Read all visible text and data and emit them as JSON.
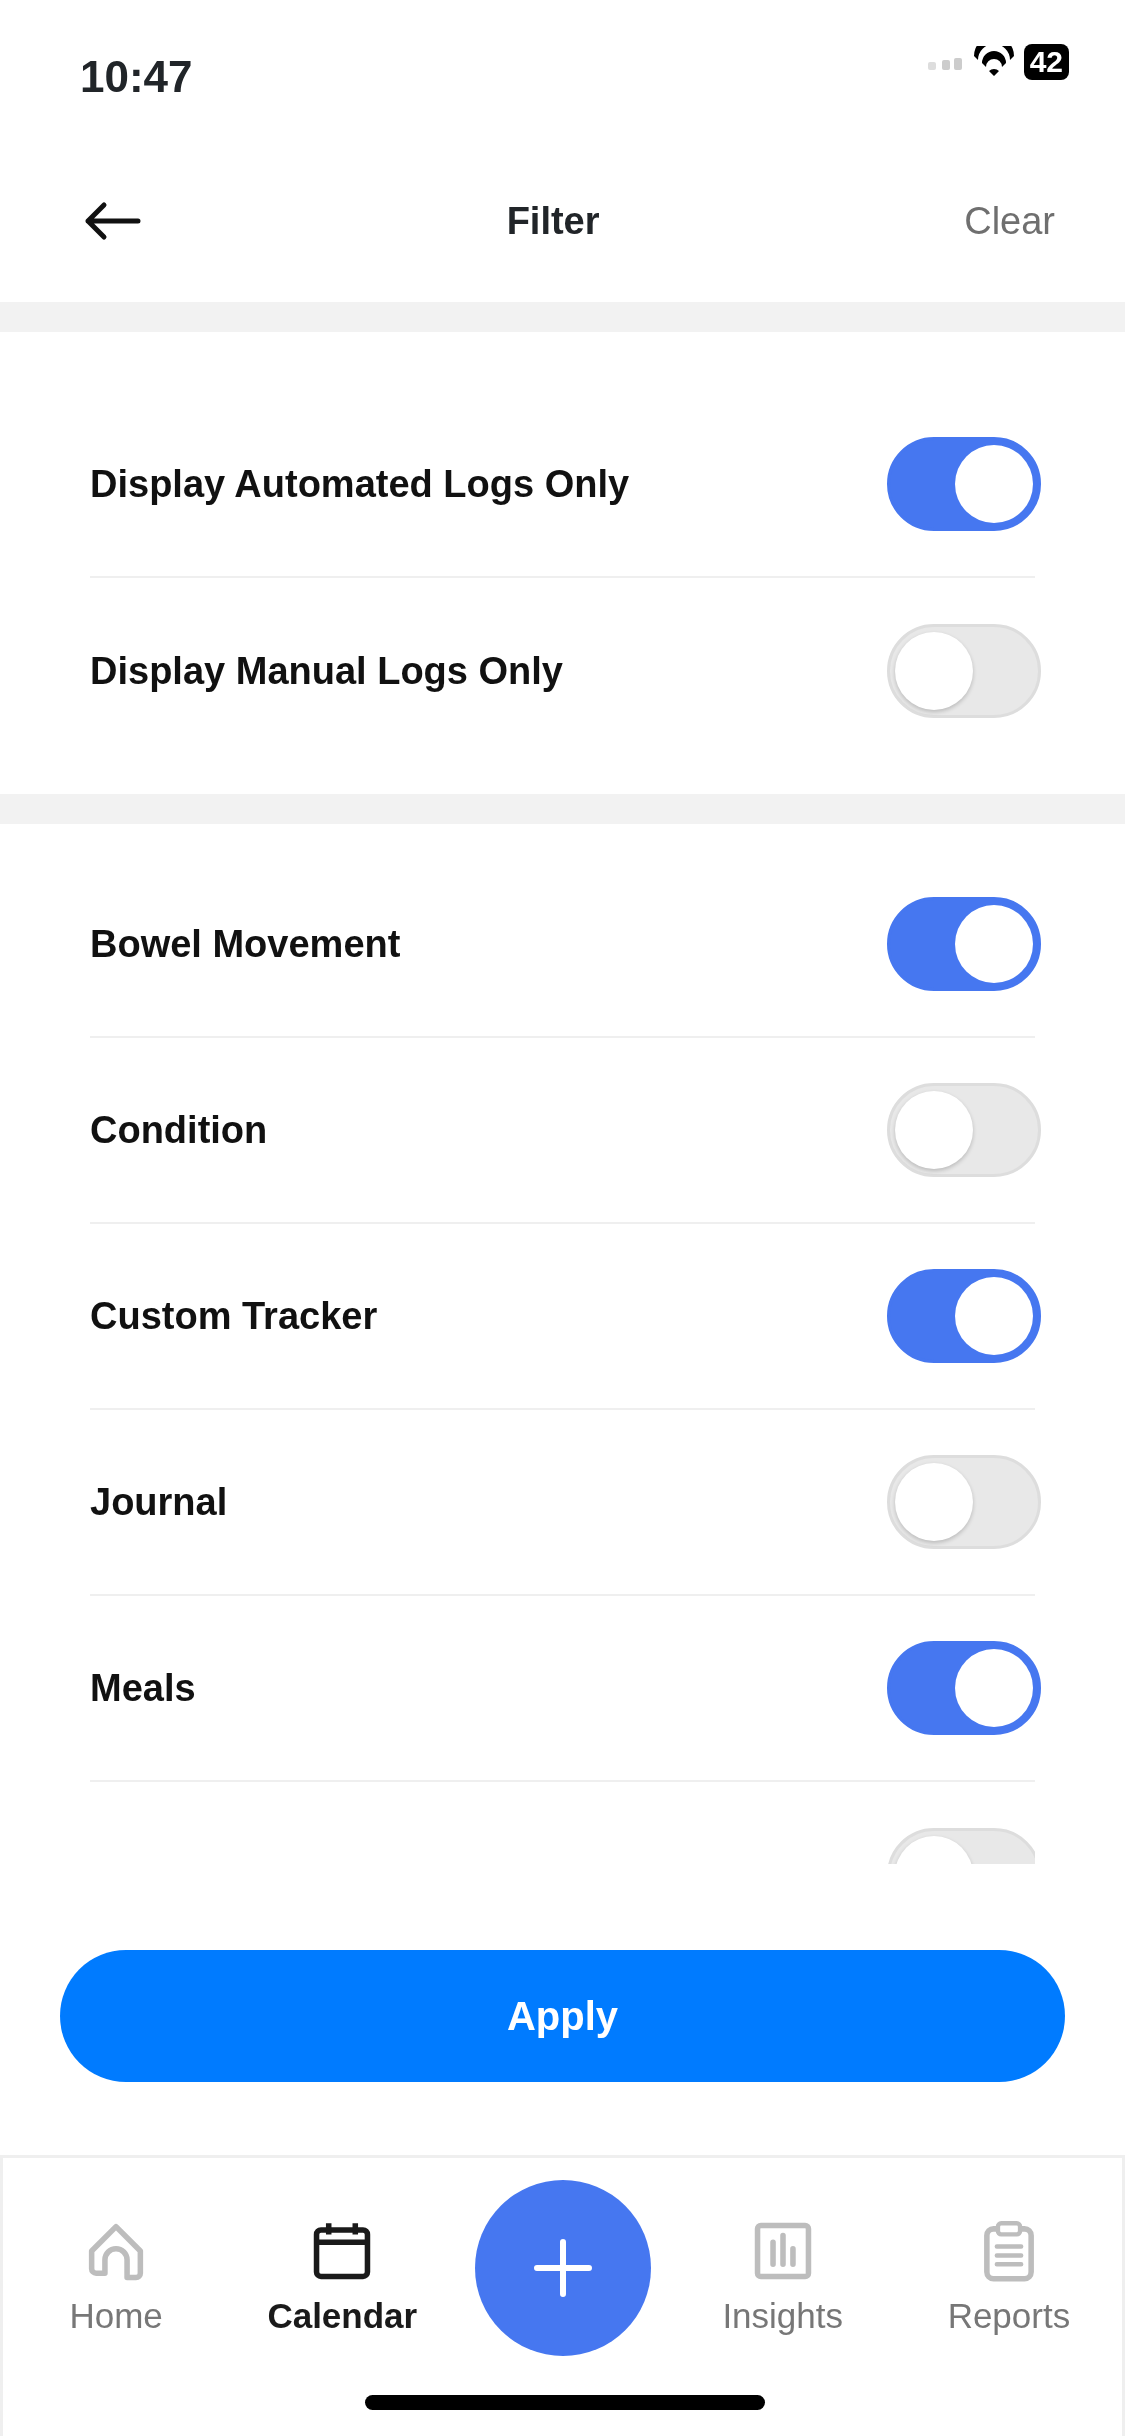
{
  "status_bar": {
    "time": "10:47",
    "battery": "42"
  },
  "header": {
    "title": "Filter",
    "action": "Clear"
  },
  "log_filters": [
    {
      "label": "Display Automated Logs Only",
      "on": true
    },
    {
      "label": "Display Manual Logs Only",
      "on": false
    }
  ],
  "categories": [
    {
      "label": "Bowel Movement",
      "on": true
    },
    {
      "label": "Condition",
      "on": false
    },
    {
      "label": "Custom Tracker",
      "on": true
    },
    {
      "label": "Journal",
      "on": false
    },
    {
      "label": "Meals",
      "on": true
    }
  ],
  "partial_row": {
    "on": false
  },
  "apply_button": "Apply",
  "tab_bar": [
    {
      "label": "Home",
      "kind": "home",
      "selected": false
    },
    {
      "label": "Calendar",
      "kind": "calendar",
      "selected": true
    },
    {
      "kind": "add"
    },
    {
      "label": "Insights",
      "kind": "insights",
      "selected": false
    },
    {
      "label": "Reports",
      "kind": "reports",
      "selected": false
    }
  ]
}
